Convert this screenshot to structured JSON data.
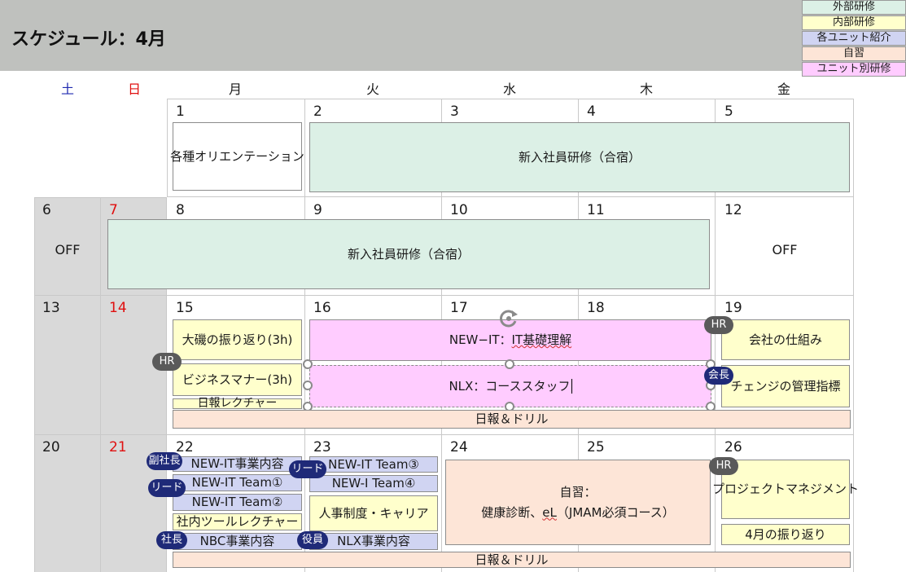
{
  "title": "スケジュール：4月",
  "legend": [
    {
      "label": "外部研修",
      "color": "#dcf0e6"
    },
    {
      "label": "内部研修",
      "color": "#ffffcc"
    },
    {
      "label": "各ユニット紹介",
      "color": "#d0d4f2"
    },
    {
      "label": "自習",
      "color": "#fde5d7"
    },
    {
      "label": "ユニット別研修",
      "color": "#ffccff"
    }
  ],
  "weekdays": [
    "土",
    "日",
    "月",
    "火",
    "水",
    "木",
    "金"
  ],
  "weekday_colors": {
    "sat": "#1f2ab0",
    "sun": "#e01010",
    "weekday": "#1a1a1a"
  },
  "dates": {
    "w1": [
      "1",
      "2",
      "3",
      "4",
      "5"
    ],
    "w2": [
      "6",
      "7",
      "8",
      "9",
      "10",
      "11",
      "12"
    ],
    "w3": [
      "13",
      "14",
      "15",
      "16",
      "17",
      "18",
      "19"
    ],
    "w4": [
      "20",
      "21",
      "22",
      "23",
      "24",
      "25",
      "26"
    ]
  },
  "events": {
    "orientation": "各種オリエンテーション",
    "training_camp_1": "新入社員研修（合宿）",
    "training_camp_2": "新入社員研修（合宿）",
    "off_sat": "OFF",
    "off_fri": "OFF",
    "review_3h": "大磯の振り返り(3h)",
    "manner_3h": "ビジネスマナー(3h)",
    "daily_lecture": "日報レクチャー",
    "new_it_basic_prefix": "NEW−IT：",
    "new_it_basic_main": "IT基礎理解",
    "nlx_staff_prefix": "NLX：コーススタッ",
    "nlx_staff_cursor": "フ",
    "company_structure": "会社の仕組み",
    "change_mgmt": "チェンジの管理指標",
    "daily_drill_1": "日報＆ドリル",
    "newit_business": "NEW-IT事業内容",
    "newit_team1": "NEW-IT Team①",
    "newit_team2": "NEW-IT Team②",
    "internal_tools": "社内ツールレクチャー",
    "nbc_business": "NBC事業内容",
    "newit_team3": "NEW-IT Team③",
    "newi_team4": "NEW-I Team④",
    "hr_career": "人事制度・キャリア",
    "nlx_business": "NLX事業内容",
    "self_study_title": "自習：",
    "self_study_body": "健康診断、",
    "self_study_el": "eL",
    "self_study_tail": "（JMAM必須コース）",
    "project_mgmt": "プロジェクトマネジメント",
    "april_review": "4月の振り返り",
    "daily_drill_2": "日報＆ドリル"
  },
  "badges": {
    "hr1": "HR",
    "hr2": "HR",
    "hr3": "HR",
    "chairman": "会長",
    "vp": "副社長",
    "lead1": "リード",
    "lead2": "リード",
    "president": "社長",
    "officer": "役員"
  }
}
